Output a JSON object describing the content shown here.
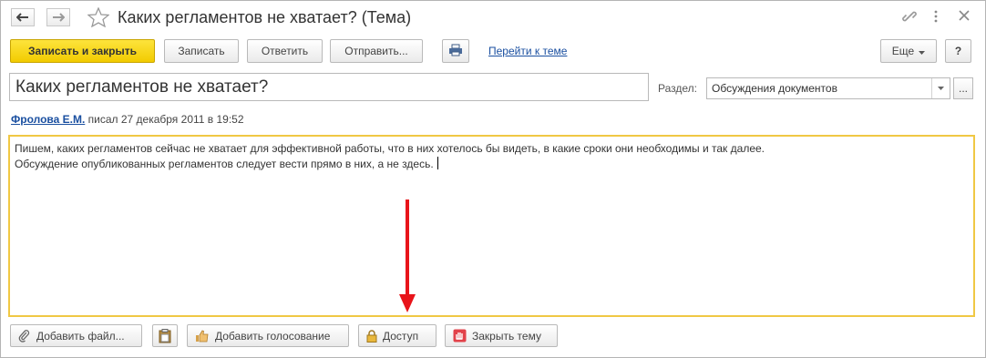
{
  "window": {
    "title": "Каких регламентов не хватает? (Тема)"
  },
  "toolbar": {
    "save_close_label": "Записать и закрыть",
    "save_label": "Записать",
    "reply_label": "Ответить",
    "send_label": "Отправить...",
    "goto_topic_label": "Перейти к теме",
    "more_label": "Еще",
    "help_label": "?"
  },
  "form": {
    "subject": "Каких регламентов не хватает?",
    "section_label": "Раздел:",
    "section_value": "Обсуждения документов",
    "author": "Фролова Е.М.",
    "posted_text": "писал 27 декабря 2011 в 19:52",
    "message_lines": [
      "Пишем, каких регламентов сейчас не хватает для эффективной работы, что в них хотелось бы видеть, в какие сроки они необходимы и так далее.",
      "Обсуждение опубликованных регламентов следует вести прямо в них, а не здесь."
    ]
  },
  "bottom": {
    "add_file_label": "Добавить файл...",
    "add_vote_label": "Добавить голосование",
    "access_label": "Доступ",
    "close_topic_label": "Закрыть тему"
  },
  "colors": {
    "primary_button": "#f7d117",
    "message_border": "#f0c844",
    "link": "#1a4fa0",
    "annotation_arrow": "#e8141a"
  },
  "icons": {
    "back": "arrow-left-icon",
    "forward": "arrow-right-icon",
    "favorite": "star-icon",
    "link": "chain-link-icon",
    "menu": "vertical-dots-icon",
    "close": "close-icon",
    "print": "printer-icon",
    "attach": "paperclip-icon",
    "paste": "clipboard-icon",
    "vote": "thumbs-up-icon",
    "access": "lock-icon",
    "close_topic": "stop-hand-icon"
  }
}
